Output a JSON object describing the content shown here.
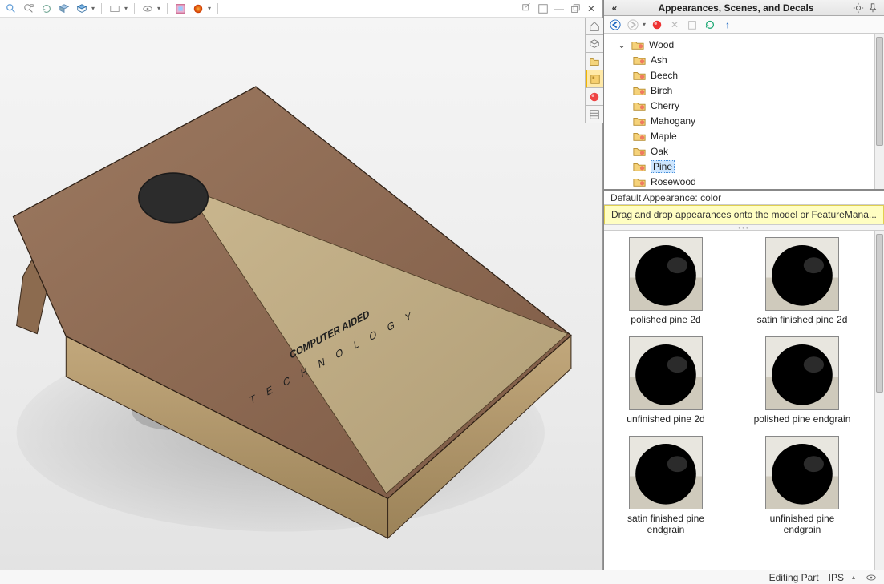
{
  "panel": {
    "title": "Appearances, Scenes, and Decals",
    "collapse_glyph": "«"
  },
  "default_appearance": "Default Appearance: color",
  "hint": "Drag and drop appearances onto the model or FeatureMana...",
  "tree": {
    "parent": "Wood",
    "items": [
      "Ash",
      "Beech",
      "Birch",
      "Cherry",
      "Mahogany",
      "Maple",
      "Oak",
      "Pine",
      "Rosewood"
    ],
    "selected": "Pine"
  },
  "swatches": [
    {
      "label": "polished pine 2d",
      "tint": "#b6c4c2"
    },
    {
      "label": "satin finished pine 2d",
      "tint": "#dccaa0"
    },
    {
      "label": "unfinished pine 2d",
      "tint": "#e1cfa3"
    },
    {
      "label": "polished pine endgrain",
      "tint": "#d9c79a"
    },
    {
      "label": "satin finished pine endgrain",
      "tint": "#dfcca0"
    },
    {
      "label": "unfinished pine endgrain",
      "tint": "#d6c496"
    }
  ],
  "model_text": {
    "line1": "COMPUTER AIDED",
    "line2": "T E C H N O L O G Y"
  },
  "status": {
    "mode": "Editing Part",
    "units": "IPS"
  },
  "top_toolbar_icons": [
    "search",
    "magnify",
    "rotate",
    "cube",
    "cube-shaded",
    "box",
    "eye",
    "layers",
    "palette",
    "appearances"
  ],
  "nav_icons": [
    "back",
    "forward",
    "dropdown",
    "appearance",
    "delete",
    "folder",
    "refresh",
    "up"
  ],
  "command_tabs": [
    "home",
    "cube-outline",
    "folder-open",
    "toolbox",
    "appearance-orb",
    "properties"
  ]
}
